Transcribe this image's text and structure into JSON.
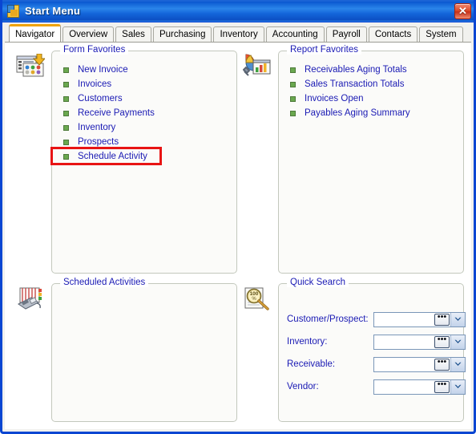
{
  "window": {
    "title": "Start Menu",
    "icon": "app-window-icon",
    "close_label": "✕",
    "accent_titlebar": "#1466da",
    "accent_active_tab": "#f0a30a",
    "highlight_color": "#e81414",
    "link_color": "#1a1ab4"
  },
  "tabs": [
    {
      "label": "Navigator",
      "active": true,
      "name": "tab-navigator"
    },
    {
      "label": "Overview",
      "active": false,
      "name": "tab-overview"
    },
    {
      "label": "Sales",
      "active": false,
      "name": "tab-sales"
    },
    {
      "label": "Purchasing",
      "active": false,
      "name": "tab-purchasing"
    },
    {
      "label": "Inventory",
      "active": false,
      "name": "tab-inventory"
    },
    {
      "label": "Accounting",
      "active": false,
      "name": "tab-accounting"
    },
    {
      "label": "Payroll",
      "active": false,
      "name": "tab-payroll"
    },
    {
      "label": "Contacts",
      "active": false,
      "name": "tab-contacts"
    },
    {
      "label": "System",
      "active": false,
      "name": "tab-system"
    }
  ],
  "form_favorites": {
    "title": "Form Favorites",
    "icon": "form-favorites-icon",
    "items": [
      {
        "label": "New Invoice",
        "highlighted": false
      },
      {
        "label": "Invoices",
        "highlighted": false
      },
      {
        "label": "Customers",
        "highlighted": false
      },
      {
        "label": "Receive Payments",
        "highlighted": false
      },
      {
        "label": "Inventory",
        "highlighted": false
      },
      {
        "label": "Prospects",
        "highlighted": false
      },
      {
        "label": "Schedule Activity",
        "highlighted": true
      }
    ]
  },
  "report_favorites": {
    "title": "Report Favorites",
    "icon": "report-chart-icon",
    "items": [
      {
        "label": "Receivables Aging Totals"
      },
      {
        "label": "Sales Transaction Totals"
      },
      {
        "label": "Invoices Open"
      },
      {
        "label": "Payables Aging Summary"
      }
    ]
  },
  "scheduled_activities": {
    "title": "Scheduled Activities",
    "icon": "phone-calendar-icon",
    "items": []
  },
  "quick_search": {
    "title": "Quick Search",
    "icon": "magnifier-icon",
    "fields": [
      {
        "label": "Customer/Prospect:",
        "value": "",
        "placeholder": "",
        "name": "quick-search-customer-prospect"
      },
      {
        "label": "Inventory:",
        "value": "",
        "placeholder": "",
        "name": "quick-search-inventory"
      },
      {
        "label": "Receivable:",
        "value": "",
        "placeholder": "",
        "name": "quick-search-receivable"
      },
      {
        "label": "Vendor:",
        "value": "",
        "placeholder": "",
        "name": "quick-search-vendor"
      }
    ],
    "ellipsis_label": "•••"
  }
}
